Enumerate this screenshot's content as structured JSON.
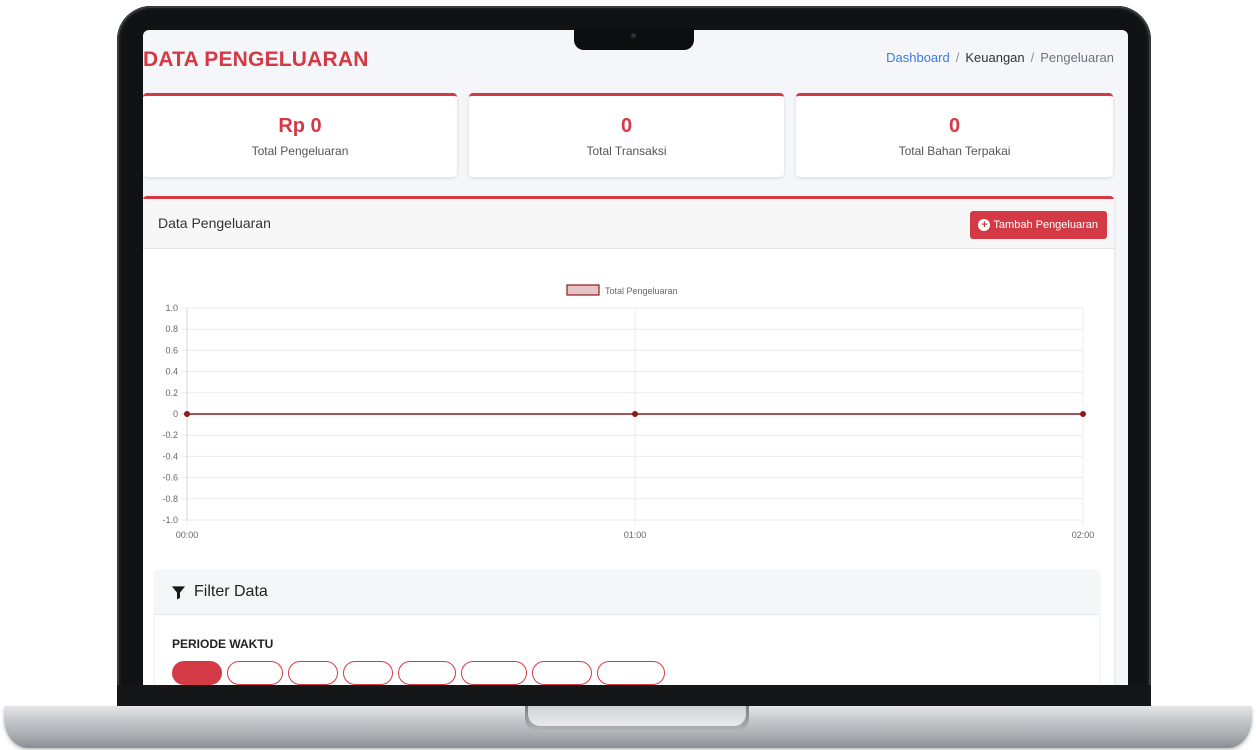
{
  "header": {
    "title": "DATA PENGELUARAN",
    "breadcrumb": [
      {
        "label": "Dashboard"
      },
      {
        "label": "Keuangan"
      },
      {
        "label": "Pengeluaran"
      }
    ]
  },
  "stats": [
    {
      "value": "Rp 0",
      "label": "Total Pengeluaran"
    },
    {
      "value": "0",
      "label": "Total Transaksi"
    },
    {
      "value": "0",
      "label": "Total Bahan Terpakai"
    }
  ],
  "main": {
    "title": "Data Pengeluaran",
    "add_button_label": "Tambah Pengeluaran"
  },
  "colors": {
    "accent": "#d43a45",
    "line": "#8b1a1a",
    "link": "#3d7be0"
  },
  "chart_data": {
    "type": "line",
    "x": [
      "00:00",
      "01:00",
      "02:00"
    ],
    "series": [
      {
        "name": "Total Pengeluaran",
        "values": [
          0,
          0,
          0
        ]
      }
    ],
    "ylim": [
      -1.0,
      1.0
    ],
    "yticks": [
      "1.0",
      "0.8",
      "0.6",
      "0.4",
      "0.2",
      "0",
      "-0.2",
      "-0.4",
      "-0.6",
      "-0.8",
      "-1.0"
    ],
    "legend_position": "top-center",
    "grid": true
  },
  "filter": {
    "title": "Filter Data",
    "periode_label": "PERIODE WAKTU"
  }
}
